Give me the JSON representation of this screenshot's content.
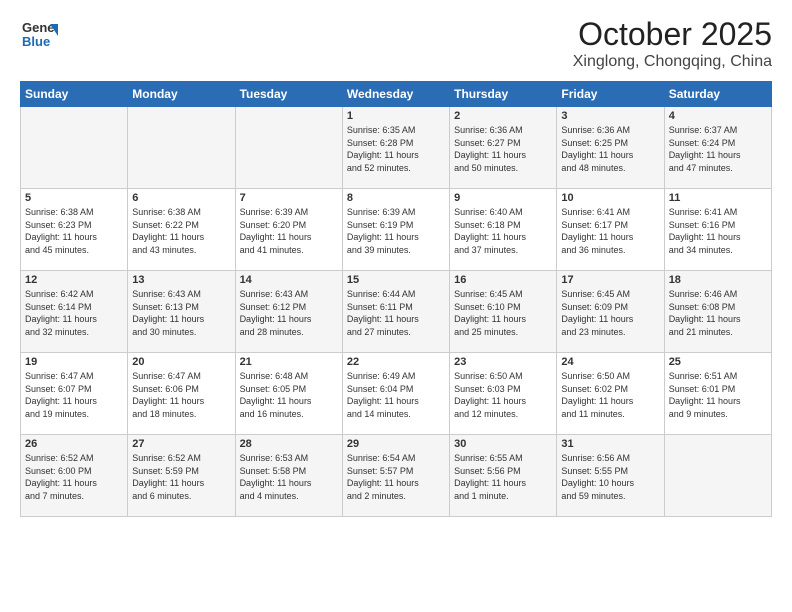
{
  "header": {
    "logo": {
      "line1": "General",
      "line2": "Blue"
    },
    "month": "October 2025",
    "location": "Xinglong, Chongqing, China"
  },
  "weekdays": [
    "Sunday",
    "Monday",
    "Tuesday",
    "Wednesday",
    "Thursday",
    "Friday",
    "Saturday"
  ],
  "weeks": [
    [
      {
        "day": "",
        "info": ""
      },
      {
        "day": "",
        "info": ""
      },
      {
        "day": "",
        "info": ""
      },
      {
        "day": "1",
        "info": "Sunrise: 6:35 AM\nSunset: 6:28 PM\nDaylight: 11 hours\nand 52 minutes."
      },
      {
        "day": "2",
        "info": "Sunrise: 6:36 AM\nSunset: 6:27 PM\nDaylight: 11 hours\nand 50 minutes."
      },
      {
        "day": "3",
        "info": "Sunrise: 6:36 AM\nSunset: 6:25 PM\nDaylight: 11 hours\nand 48 minutes."
      },
      {
        "day": "4",
        "info": "Sunrise: 6:37 AM\nSunset: 6:24 PM\nDaylight: 11 hours\nand 47 minutes."
      }
    ],
    [
      {
        "day": "5",
        "info": "Sunrise: 6:38 AM\nSunset: 6:23 PM\nDaylight: 11 hours\nand 45 minutes."
      },
      {
        "day": "6",
        "info": "Sunrise: 6:38 AM\nSunset: 6:22 PM\nDaylight: 11 hours\nand 43 minutes."
      },
      {
        "day": "7",
        "info": "Sunrise: 6:39 AM\nSunset: 6:20 PM\nDaylight: 11 hours\nand 41 minutes."
      },
      {
        "day": "8",
        "info": "Sunrise: 6:39 AM\nSunset: 6:19 PM\nDaylight: 11 hours\nand 39 minutes."
      },
      {
        "day": "9",
        "info": "Sunrise: 6:40 AM\nSunset: 6:18 PM\nDaylight: 11 hours\nand 37 minutes."
      },
      {
        "day": "10",
        "info": "Sunrise: 6:41 AM\nSunset: 6:17 PM\nDaylight: 11 hours\nand 36 minutes."
      },
      {
        "day": "11",
        "info": "Sunrise: 6:41 AM\nSunset: 6:16 PM\nDaylight: 11 hours\nand 34 minutes."
      }
    ],
    [
      {
        "day": "12",
        "info": "Sunrise: 6:42 AM\nSunset: 6:14 PM\nDaylight: 11 hours\nand 32 minutes."
      },
      {
        "day": "13",
        "info": "Sunrise: 6:43 AM\nSunset: 6:13 PM\nDaylight: 11 hours\nand 30 minutes."
      },
      {
        "day": "14",
        "info": "Sunrise: 6:43 AM\nSunset: 6:12 PM\nDaylight: 11 hours\nand 28 minutes."
      },
      {
        "day": "15",
        "info": "Sunrise: 6:44 AM\nSunset: 6:11 PM\nDaylight: 11 hours\nand 27 minutes."
      },
      {
        "day": "16",
        "info": "Sunrise: 6:45 AM\nSunset: 6:10 PM\nDaylight: 11 hours\nand 25 minutes."
      },
      {
        "day": "17",
        "info": "Sunrise: 6:45 AM\nSunset: 6:09 PM\nDaylight: 11 hours\nand 23 minutes."
      },
      {
        "day": "18",
        "info": "Sunrise: 6:46 AM\nSunset: 6:08 PM\nDaylight: 11 hours\nand 21 minutes."
      }
    ],
    [
      {
        "day": "19",
        "info": "Sunrise: 6:47 AM\nSunset: 6:07 PM\nDaylight: 11 hours\nand 19 minutes."
      },
      {
        "day": "20",
        "info": "Sunrise: 6:47 AM\nSunset: 6:06 PM\nDaylight: 11 hours\nand 18 minutes."
      },
      {
        "day": "21",
        "info": "Sunrise: 6:48 AM\nSunset: 6:05 PM\nDaylight: 11 hours\nand 16 minutes."
      },
      {
        "day": "22",
        "info": "Sunrise: 6:49 AM\nSunset: 6:04 PM\nDaylight: 11 hours\nand 14 minutes."
      },
      {
        "day": "23",
        "info": "Sunrise: 6:50 AM\nSunset: 6:03 PM\nDaylight: 11 hours\nand 12 minutes."
      },
      {
        "day": "24",
        "info": "Sunrise: 6:50 AM\nSunset: 6:02 PM\nDaylight: 11 hours\nand 11 minutes."
      },
      {
        "day": "25",
        "info": "Sunrise: 6:51 AM\nSunset: 6:01 PM\nDaylight: 11 hours\nand 9 minutes."
      }
    ],
    [
      {
        "day": "26",
        "info": "Sunrise: 6:52 AM\nSunset: 6:00 PM\nDaylight: 11 hours\nand 7 minutes."
      },
      {
        "day": "27",
        "info": "Sunrise: 6:52 AM\nSunset: 5:59 PM\nDaylight: 11 hours\nand 6 minutes."
      },
      {
        "day": "28",
        "info": "Sunrise: 6:53 AM\nSunset: 5:58 PM\nDaylight: 11 hours\nand 4 minutes."
      },
      {
        "day": "29",
        "info": "Sunrise: 6:54 AM\nSunset: 5:57 PM\nDaylight: 11 hours\nand 2 minutes."
      },
      {
        "day": "30",
        "info": "Sunrise: 6:55 AM\nSunset: 5:56 PM\nDaylight: 11 hours\nand 1 minute."
      },
      {
        "day": "31",
        "info": "Sunrise: 6:56 AM\nSunset: 5:55 PM\nDaylight: 10 hours\nand 59 minutes."
      },
      {
        "day": "",
        "info": ""
      }
    ]
  ]
}
